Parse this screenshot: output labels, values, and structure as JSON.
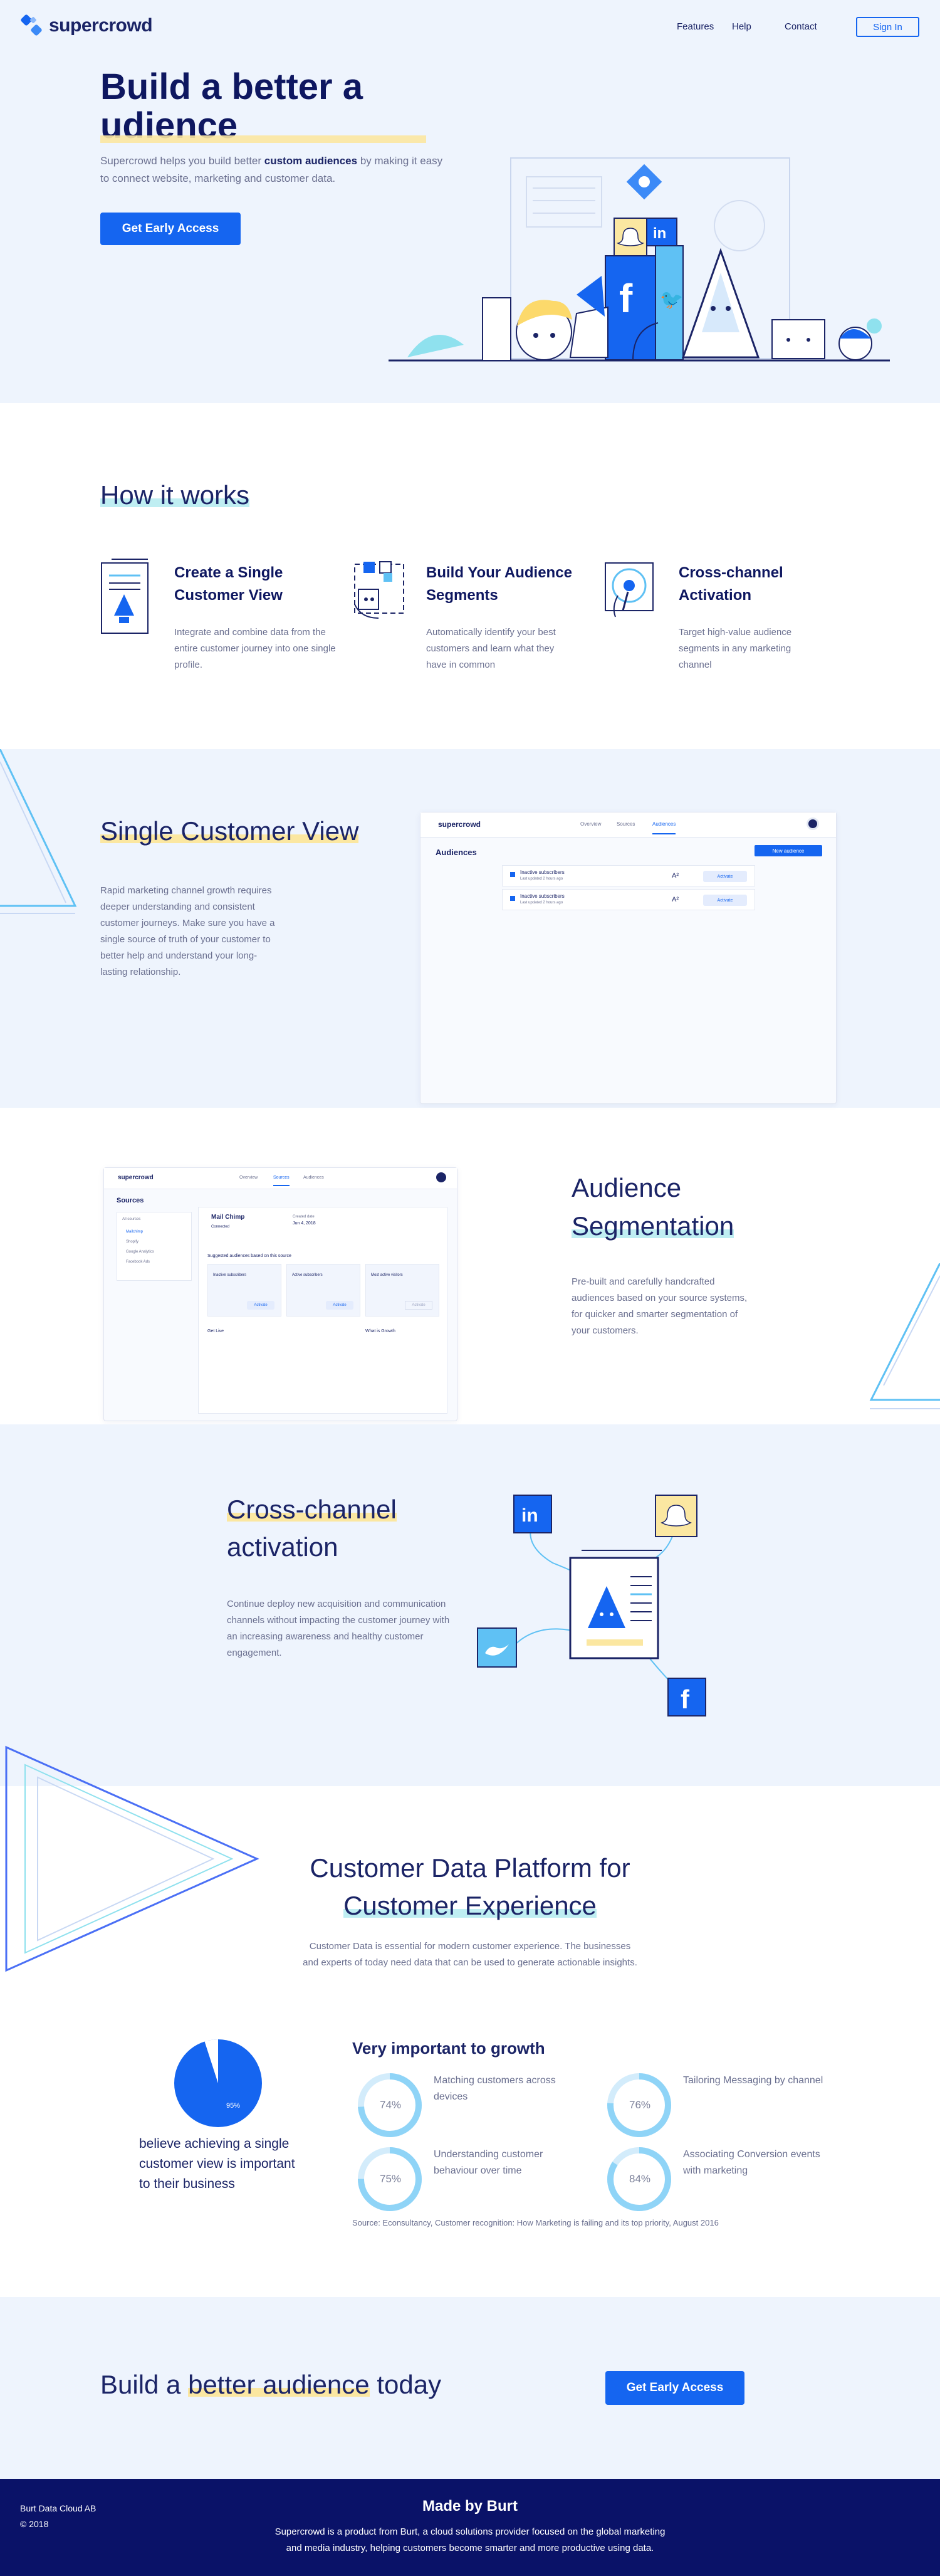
{
  "header": {
    "brand": "supercrowd",
    "nav": [
      "Features",
      "Help",
      "Contact"
    ],
    "signin": "Sign In"
  },
  "hero": {
    "title_line1": "Build a better a",
    "title_line2": "udience",
    "desc_pre": "Supercrowd helps you build better ",
    "desc_bold": "custom audiences",
    "desc_post": " by making it easy to connect website, marketing and customer data.",
    "cta": "Get Early Access"
  },
  "how": {
    "title": "How it works",
    "items": [
      {
        "title": "Create a Single Customer View",
        "desc": "Integrate and combine data from the entire customer journey into one single profile."
      },
      {
        "title": "Build Your Audience Segments",
        "desc": "Automatically identify your best customers and learn what they have in common"
      },
      {
        "title": "Cross-channel Activation",
        "desc": "Target high-value audience segments in any marketing channel"
      }
    ]
  },
  "scv": {
    "title": "Single Customer View",
    "desc": "Rapid marketing channel growth requires deeper understanding and consistent customer journeys. Make sure you have a single source of truth of your customer to better help and understand your long-lasting relationship.",
    "mock": {
      "brand": "supercrowd",
      "tabs": [
        "Overview",
        "Sources",
        "Audiences"
      ],
      "heading": "Audiences",
      "new_btn": "New audience",
      "rows": [
        {
          "name": "Inactive subscribers",
          "sub": "Last updated 2 hours ago",
          "action": "Activate"
        },
        {
          "name": "Inactive subscribers",
          "sub": "Last updated 2 hours ago",
          "action": "Activate"
        }
      ]
    }
  },
  "seg": {
    "title_line1": "Audience",
    "title_line2": "Segmentation",
    "desc": "Pre-built and carefully handcrafted audiences based on your source systems, for quicker and smarter segmentation of your customers.",
    "mock": {
      "brand": "supercrowd",
      "tabs": [
        "Overview",
        "Sources",
        "Audiences"
      ],
      "heading": "Sources",
      "side_title": "All sources",
      "side_items": [
        "Mailchimp",
        "Shopify",
        "Google Analytics",
        "Facebook Ads"
      ],
      "source_name": "Mail Chimp",
      "connected": "Connected",
      "created_label": "Created date",
      "created": "Jun 4, 2018",
      "sub_heading": "Suggested audiences based on this source",
      "cards": [
        "Inactive subscribers",
        "Active subscribers",
        "Most active visitors"
      ],
      "card_btn": "Activate",
      "about_title": "Get Live",
      "more_title": "What is Growth"
    }
  },
  "cross": {
    "title_line1": "Cross-channel",
    "title_line2": "activation",
    "desc": "Continue deploy new acquisition and communication channels without impacting the customer journey with an increasing awareness and healthy customer engagement."
  },
  "cdp": {
    "title_line1": "Customer Data Platform for",
    "title_line2": "Customer Experience",
    "desc": "Customer Data is essential for modern customer experience. The businesses and experts of today need data that can be used to generate actionable insights."
  },
  "stats": {
    "pie_value": "95%",
    "pie_caption": "believe achieving a single customer view is important to their business",
    "heading": "Very important to growth",
    "items": [
      {
        "value": "74%",
        "label": "Matching customers across devices"
      },
      {
        "value": "76%",
        "label": "Tailoring Messaging by channel"
      },
      {
        "value": "75%",
        "label": "Understanding customer behaviour over time"
      },
      {
        "value": "84%",
        "label": "Associating Conversion events with marketing"
      }
    ],
    "source": "Source: Econsultancy, Customer recognition: How Marketing is failing and its top priority, August 2016"
  },
  "cta_band": {
    "title_pre": "Build a ",
    "title_hl": "better audience",
    "title_post": " today",
    "button": "Get Early Access"
  },
  "footer": {
    "company": "Burt Data Cloud AB",
    "copyright": "© 2018",
    "made_by": "Made by Burt",
    "desc_line1": "Supercrowd is a product from Burt, a cloud solutions provider focused on the global marketing",
    "desc_line2": "and media industry, helping customers become smarter and more productive using data."
  },
  "colors": {
    "primary": "#1565f0",
    "navy": "#0a1268",
    "light_bg": "#eef4fd",
    "yellow_highlight": "#fbe7a1",
    "cyan_highlight": "#bfeef2"
  },
  "icons": [
    "supercrowd-logo-icon",
    "linkedin-icon",
    "facebook-icon",
    "twitter-icon",
    "snapchat-icon",
    "document-icon",
    "segments-icon",
    "activation-icon"
  ]
}
